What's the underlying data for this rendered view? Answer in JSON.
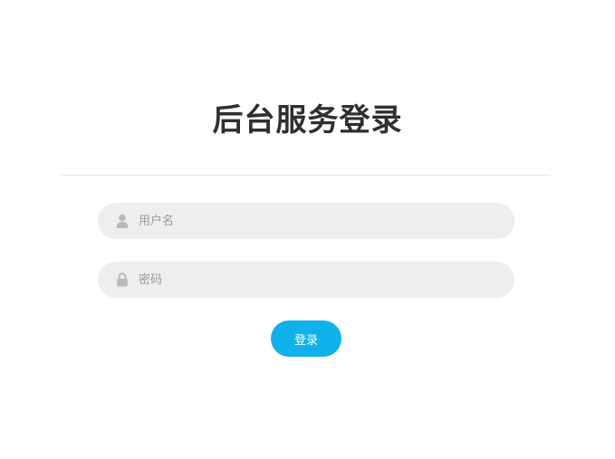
{
  "login": {
    "title": "后台服务登录",
    "username_placeholder": "用户名",
    "username_value": "",
    "password_placeholder": "密码",
    "password_value": "",
    "submit_label": "登录"
  },
  "icons": {
    "username": "user-icon",
    "password": "lock-icon"
  },
  "colors": {
    "title": "#2f2f2f",
    "input_background": "#eeeeee",
    "placeholder": "#9a9a9a",
    "icon": "#b9b9b9",
    "button": "#0eb1ea",
    "button_text": "#ffffff",
    "divider": "#e6e6e6"
  }
}
